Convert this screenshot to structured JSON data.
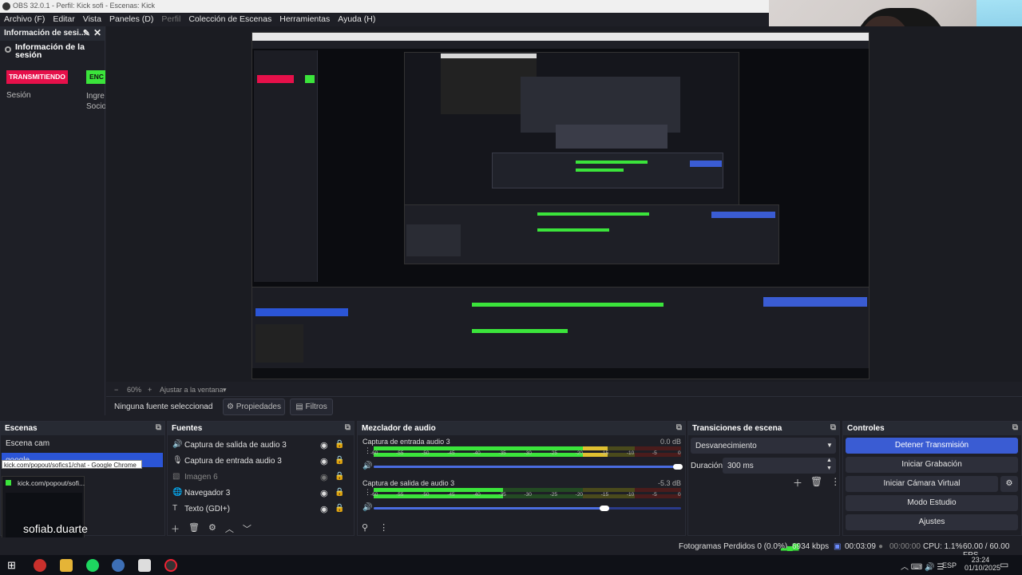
{
  "window": {
    "title": "OBS 32.0.1 - Perfil: Kick sofi - Escenas: Kick"
  },
  "menu": [
    "Archivo (F)",
    "Editar",
    "Vista",
    "Paneles (D)",
    "Perfil",
    "Colección de Escenas",
    "Herramientas",
    "Ayuda (H)"
  ],
  "info_dock": {
    "header": "Información de sesi...",
    "title": "Información de la sesión",
    "live_badge": "TRANSMITIENDO",
    "green_badge": "ENC",
    "session_label": "Sesión",
    "income_label": "Ingre Socio"
  },
  "zoom": {
    "value": "60%",
    "fit_label": "Ajustar a la ventana"
  },
  "props": {
    "no_selection": "Ninguna fuente seleccionad",
    "properties": "Propiedades",
    "filters": "Filtros"
  },
  "scenes": {
    "header": "Escenas",
    "items": [
      "Escena cam",
      "google"
    ],
    "tooltip": "kick.com/popout/sofics1/chat - Google Chrome",
    "thumb_label": "kick.com/popout/sofi...",
    "overlay_text": "sofiab.duarte"
  },
  "sources": {
    "header": "Fuentes",
    "items": [
      {
        "icon": "speaker-icon",
        "label": "Captura de salida de audio 3",
        "dim": false
      },
      {
        "icon": "mic-icon",
        "label": "Captura de entrada audio 3",
        "dim": false
      },
      {
        "icon": "image-icon",
        "label": "Imagen 6",
        "dim": true
      },
      {
        "icon": "browser-icon",
        "label": "Navegador 3",
        "dim": false
      },
      {
        "icon": "text-icon",
        "label": "Texto (GDI+)",
        "dim": false
      }
    ]
  },
  "mixer": {
    "header": "Mezclador de audio",
    "channels": [
      {
        "name": "Captura de entrada audio 3",
        "db": "0.0 dB",
        "level": 0.76,
        "vol": 0.99
      },
      {
        "name": "Captura de salida de audio 3",
        "db": "-5.3 dB",
        "level": 0.42,
        "vol": 0.75
      }
    ],
    "ticks": [
      "-60",
      "-55",
      "-50",
      "-45",
      "-40",
      "-35",
      "-30",
      "-25",
      "-20",
      "-15",
      "-10",
      "-5",
      "0"
    ]
  },
  "transitions": {
    "header": "Transiciones de escena",
    "selected": "Desvanecimiento",
    "duration_label": "Duración",
    "duration_value": "300 ms"
  },
  "controls": {
    "header": "Controles",
    "stop_stream": "Detener Transmisión",
    "start_rec": "Iniciar Grabación",
    "virtual_cam": "Iniciar Cámara Virtual",
    "studio": "Modo Estudio",
    "settings": "Ajustes"
  },
  "status": {
    "dropped": "Fotogramas Perdidos 0 (0.0%)",
    "bitrate": "6934 kbps",
    "stream_time": "00:03:09",
    "rec_time": "00:00:00",
    "cpu": "CPU: 1.1%",
    "fps": "60.00 / 60.00 FPS"
  },
  "taskbar": {
    "lang": "ESP",
    "time": "23:24",
    "date": "01/10/2025"
  },
  "colors": {
    "accent": "#3a5cd3",
    "live": "#e6104a",
    "green": "#3be43b"
  }
}
